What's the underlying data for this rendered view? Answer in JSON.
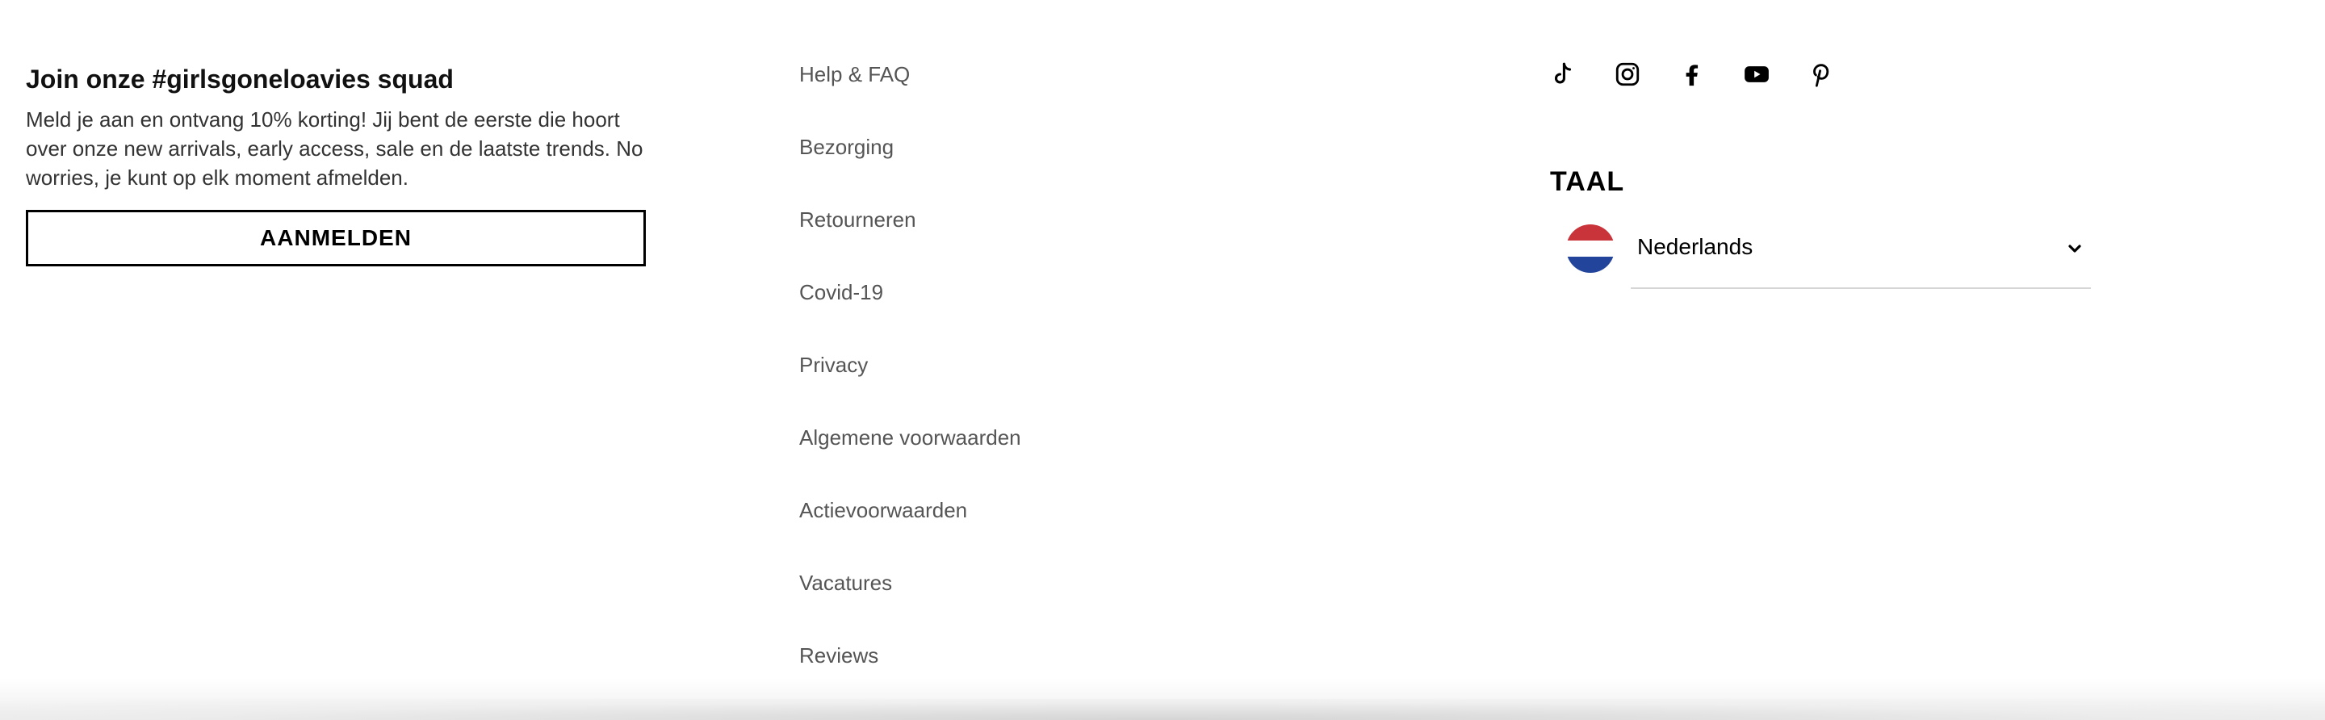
{
  "newsletter": {
    "title": "Join onze #girlsgoneloavies squad",
    "text": "Meld je aan en ontvang 10% korting! Jij bent de eerste die hoort over onze new arrivals, early access, sale en de laatste trends. No worries, je kunt op elk moment afmelden.",
    "button_label": "AANMELDEN"
  },
  "links": [
    {
      "label": "Help & FAQ"
    },
    {
      "label": "Bezorging"
    },
    {
      "label": "Retourneren"
    },
    {
      "label": "Covid-19"
    },
    {
      "label": "Privacy"
    },
    {
      "label": "Algemene voorwaarden"
    },
    {
      "label": "Actievoorwaarden"
    },
    {
      "label": "Vacatures"
    },
    {
      "label": "Reviews"
    }
  ],
  "social": [
    {
      "icon": "tiktok-icon"
    },
    {
      "icon": "instagram-icon"
    },
    {
      "icon": "facebook-icon"
    },
    {
      "icon": "youtube-icon"
    },
    {
      "icon": "pinterest-icon"
    }
  ],
  "language": {
    "title": "TAAL",
    "selected": "Nederlands",
    "flag_colors": [
      "#c8343a",
      "#ffffff",
      "#23449b"
    ]
  }
}
